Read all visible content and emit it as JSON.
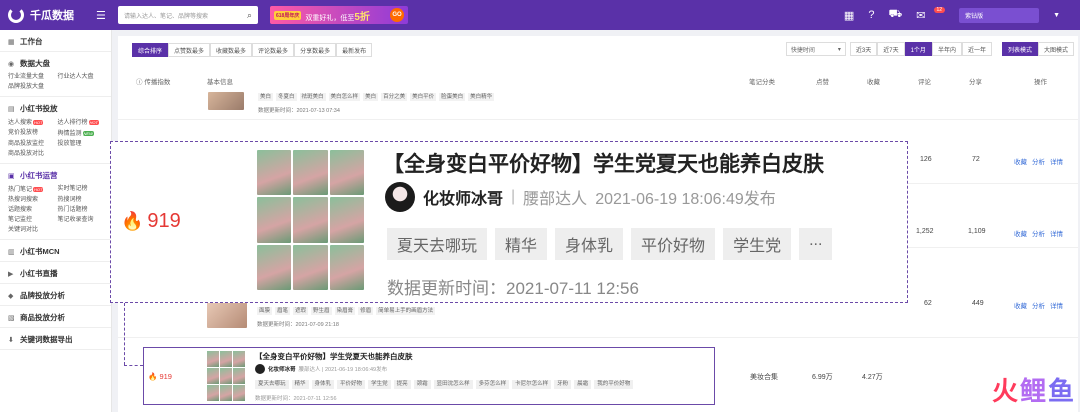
{
  "topbar": {
    "logo": "千瓜数据",
    "search_placeholder": "请输入达人、笔记、品牌等搜索",
    "promo_tag": "618周年庆",
    "promo_text": "双重好礼，低至",
    "promo_discount": "5折",
    "promo_go": "GO",
    "notify_count": "12",
    "vip": "紫钻版"
  },
  "sidebar": {
    "workbench": "工作台",
    "data_section": "数据大盘",
    "data_items": [
      "行业流量大盘",
      "行业达人大盘",
      "品牌投放大盘"
    ],
    "analysis_section": "小红书投放",
    "analysis_items": [
      "达人搜索",
      "达人排行榜",
      "竞价投放榜",
      "舆情监测",
      "商品投放监控",
      "投放管理",
      "商品投放对比"
    ],
    "ops_section": "小红书运营",
    "ops_items": [
      "热门笔记",
      "实时笔记榜",
      "热搜词搜索",
      "热搜词榜",
      "话题搜索",
      "热门话题榜",
      "笔记监控",
      "笔记收录查询",
      "关键词对比"
    ],
    "mcn": "小红书MCN",
    "live": "小红书直播",
    "brand": "品牌投放分析",
    "goods": "商品投放分析",
    "keyword_export": "关键词数据导出"
  },
  "toolbar": {
    "sorts": [
      "综合排序",
      "点赞数最多",
      "收藏数最多",
      "评论数最多",
      "分享数最多",
      "最新发布"
    ],
    "quick_time": "快捷时间",
    "ranges": [
      "近3天",
      "近7天",
      "1个月",
      "半年内",
      "近一年"
    ],
    "views": [
      "列表模式",
      "大图模式"
    ]
  },
  "table": {
    "headers": [
      "传播指数",
      "基本信息",
      "笔记分类",
      "点赞",
      "收藏",
      "评论",
      "分享",
      "操作"
    ],
    "row1": {
      "tags": [
        "美白",
        "冬夏白",
        "祛斑美白",
        "美白怎么样",
        "美白",
        "百分之美",
        "美白平价",
        "脸蛋美白",
        "美白精华"
      ],
      "update": "数据更新时间：2021-07-13 07:34"
    },
    "row2": {
      "comments": "126",
      "shares": "72",
      "actions": [
        "收藏",
        "分析",
        "详情"
      ]
    },
    "row3": {
      "comments": "1,252",
      "shares": "1,109",
      "actions": [
        "收藏",
        "分析",
        "详情"
      ]
    },
    "row4": {
      "comments": "62",
      "shares": "449",
      "actions": [
        "收藏",
        "分析",
        "详情"
      ],
      "tags": [
        "面膜",
        "眉笔",
        "遮瑕",
        "野生眉",
        "染眉膏",
        "修眉",
        "简单易上手的画眉方法"
      ],
      "update": "数据更新时间：2021-07-09 21:18"
    },
    "row5": {
      "category": "美妆合集",
      "likes": "6.99万",
      "collects": "4.27万"
    }
  },
  "zoom": {
    "spread": "919",
    "title": "【全身变白平价好物】学生党夏天也能养白皮肤",
    "author": "化妆师冰哥",
    "author_level": "腰部达人",
    "published": "2021-06-19 18:06:49发布",
    "tags": [
      "夏天去哪玩",
      "精华",
      "身体乳",
      "平价好物",
      "学生党",
      "..."
    ],
    "update": "数据更新时间：2021-07-11 12:56"
  },
  "highlight": {
    "spread": "919",
    "title": "【全身变白平价好物】学生党夏天也能养白皮肤",
    "author": "化妆师冰哥",
    "meta": "腰部达人 | 2021-06-19 18:06:49发布",
    "tags": [
      "夏天去哪玩",
      "精华",
      "身体乳",
      "平价好物",
      "学生党",
      "提亮",
      "颈霜",
      "显田沈怎么样",
      "多芬怎么样",
      "卡尼尔怎么样",
      "牙粉",
      "晨霜",
      "我的平价好物"
    ],
    "update": "数据更新时间：2021-07-11 12:56"
  },
  "watermark": [
    "火",
    "鲤",
    "鱼"
  ]
}
